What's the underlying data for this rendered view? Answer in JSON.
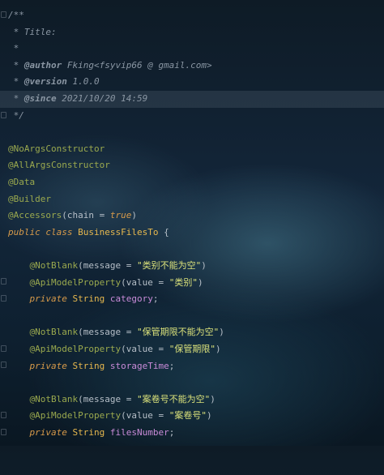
{
  "header_comment": {
    "open": "/**",
    "title_line": " * Title:",
    "empty_line": " *",
    "author_tag": "@author",
    "author_value": " Fking<fsyvip66 @ gmail.com>",
    "version_tag": "@version",
    "version_value": " 1.0.0",
    "since_tag": "@since",
    "since_value": " 2021/10/20 14:59",
    "close": " */",
    "star_prefix": " * "
  },
  "annotations": {
    "no_args": "@NoArgsConstructor",
    "all_args": "@AllArgsConstructor",
    "data": "@Data",
    "builder": "@Builder",
    "accessors_name": "@Accessors",
    "accessors_open": "(chain = ",
    "accessors_value": "true",
    "accessors_close": ")"
  },
  "class_decl": {
    "public_kw": "public",
    "class_kw": "class",
    "name": "BusinessFilesTo",
    "brace": " {"
  },
  "fields": [
    {
      "notblank": "@NotBlank",
      "notblank_open": "(message = ",
      "message": "\"类别不能为空\"",
      "close": ")",
      "apimodel": "@ApiModelProperty",
      "apimodel_open": "(value = ",
      "value": "\"类别\"",
      "private_kw": "private",
      "type": "String",
      "name": "category",
      "semicolon": ";"
    },
    {
      "notblank": "@NotBlank",
      "notblank_open": "(message = ",
      "message": "\"保管期限不能为空\"",
      "close": ")",
      "apimodel": "@ApiModelProperty",
      "apimodel_open": "(value = ",
      "value": "\"保管期限\"",
      "private_kw": "private",
      "type": "String",
      "name": "storageTime",
      "semicolon": ";"
    },
    {
      "notblank": "@NotBlank",
      "notblank_open": "(message = ",
      "message": "\"案卷号不能为空\"",
      "close": ")",
      "apimodel": "@ApiModelProperty",
      "apimodel_open": "(value = ",
      "value": "\"案卷号\"",
      "private_kw": "private",
      "type": "String",
      "name": "filesNumber",
      "semicolon": ";"
    }
  ],
  "indent": "    ",
  "fold_icon": "fold-marker-icon"
}
